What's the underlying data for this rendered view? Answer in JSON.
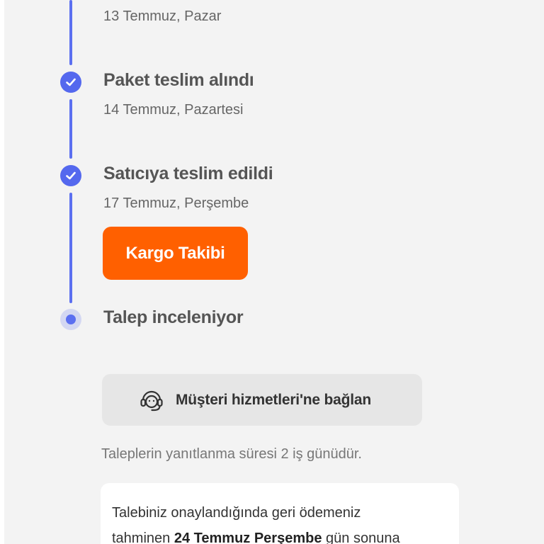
{
  "timeline": {
    "steps": [
      {
        "title": "",
        "date": "13 Temmuz, Pazar",
        "state": "done"
      },
      {
        "title": "Paket teslim alındı",
        "date": "14 Temmuz, Pazartesi",
        "state": "done"
      },
      {
        "title": "Satıcıya teslim edildi",
        "date": "17 Temmuz, Perşembe",
        "state": "done"
      },
      {
        "title": "Talep inceleniyor",
        "date": "",
        "state": "current"
      }
    ],
    "track_button_label": "Kargo Takibi"
  },
  "support": {
    "button_label": "Müşteri hizmetleri'ne bağlan",
    "icon": "headset-icon"
  },
  "response_note": "Taleplerin yanıtlanma süresi 2 iş günüdür.",
  "refund_info": {
    "line1": "Talebiniz onaylandığında geri ödemeniz",
    "line2_prefix": "tahminen ",
    "line2_bold": "24 Temmuz Perşembe",
    "line2_suffix": " gün sonuna"
  },
  "colors": {
    "accent": "#5468ee",
    "cta": "#ff6000",
    "panel_bg": "#f3f3f3"
  }
}
